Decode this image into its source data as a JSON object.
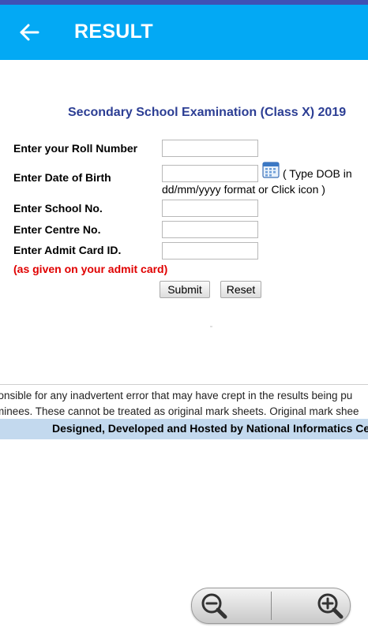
{
  "appbar": {
    "title": "RESULT"
  },
  "exam": {
    "title": "Secondary School Examination (Class X) 2019"
  },
  "form": {
    "roll_label": "Enter your Roll Number",
    "dob_label": "Enter Date of Birth",
    "dob_hint_1": "( Type DOB in",
    "dob_hint_2": "dd/mm/yyyy format or Click icon )",
    "school_label": "Enter School No.",
    "centre_label": "Enter Centre No.",
    "admit_label": "Enter Admit Card ID.",
    "admit_note": "(as given on your admit card)",
    "roll_value": "",
    "dob_value": "",
    "school_value": "",
    "centre_value": "",
    "admit_value": ""
  },
  "buttons": {
    "submit": "Submit",
    "reset": "Reset"
  },
  "disclaimer": {
    "line1": "ponsible for any inadvertent error that may have crept in the results being pu",
    "line2": "minees. These cannot be treated as original mark sheets. Original mark shee"
  },
  "footer": {
    "text": "Designed, Developed and Hosted by National Informatics Centre"
  },
  "icons": {
    "back": "arrow-left-icon",
    "calendar": "calendar-icon",
    "zoom_out": "zoom-out-icon",
    "zoom_in": "zoom-in-icon"
  },
  "colors": {
    "appbar": "#03a9f4",
    "statusbar": "#3f51b5",
    "exam_title": "#2c3e94",
    "note_red": "#e00000",
    "footer_bg": "#c3d9ee"
  }
}
